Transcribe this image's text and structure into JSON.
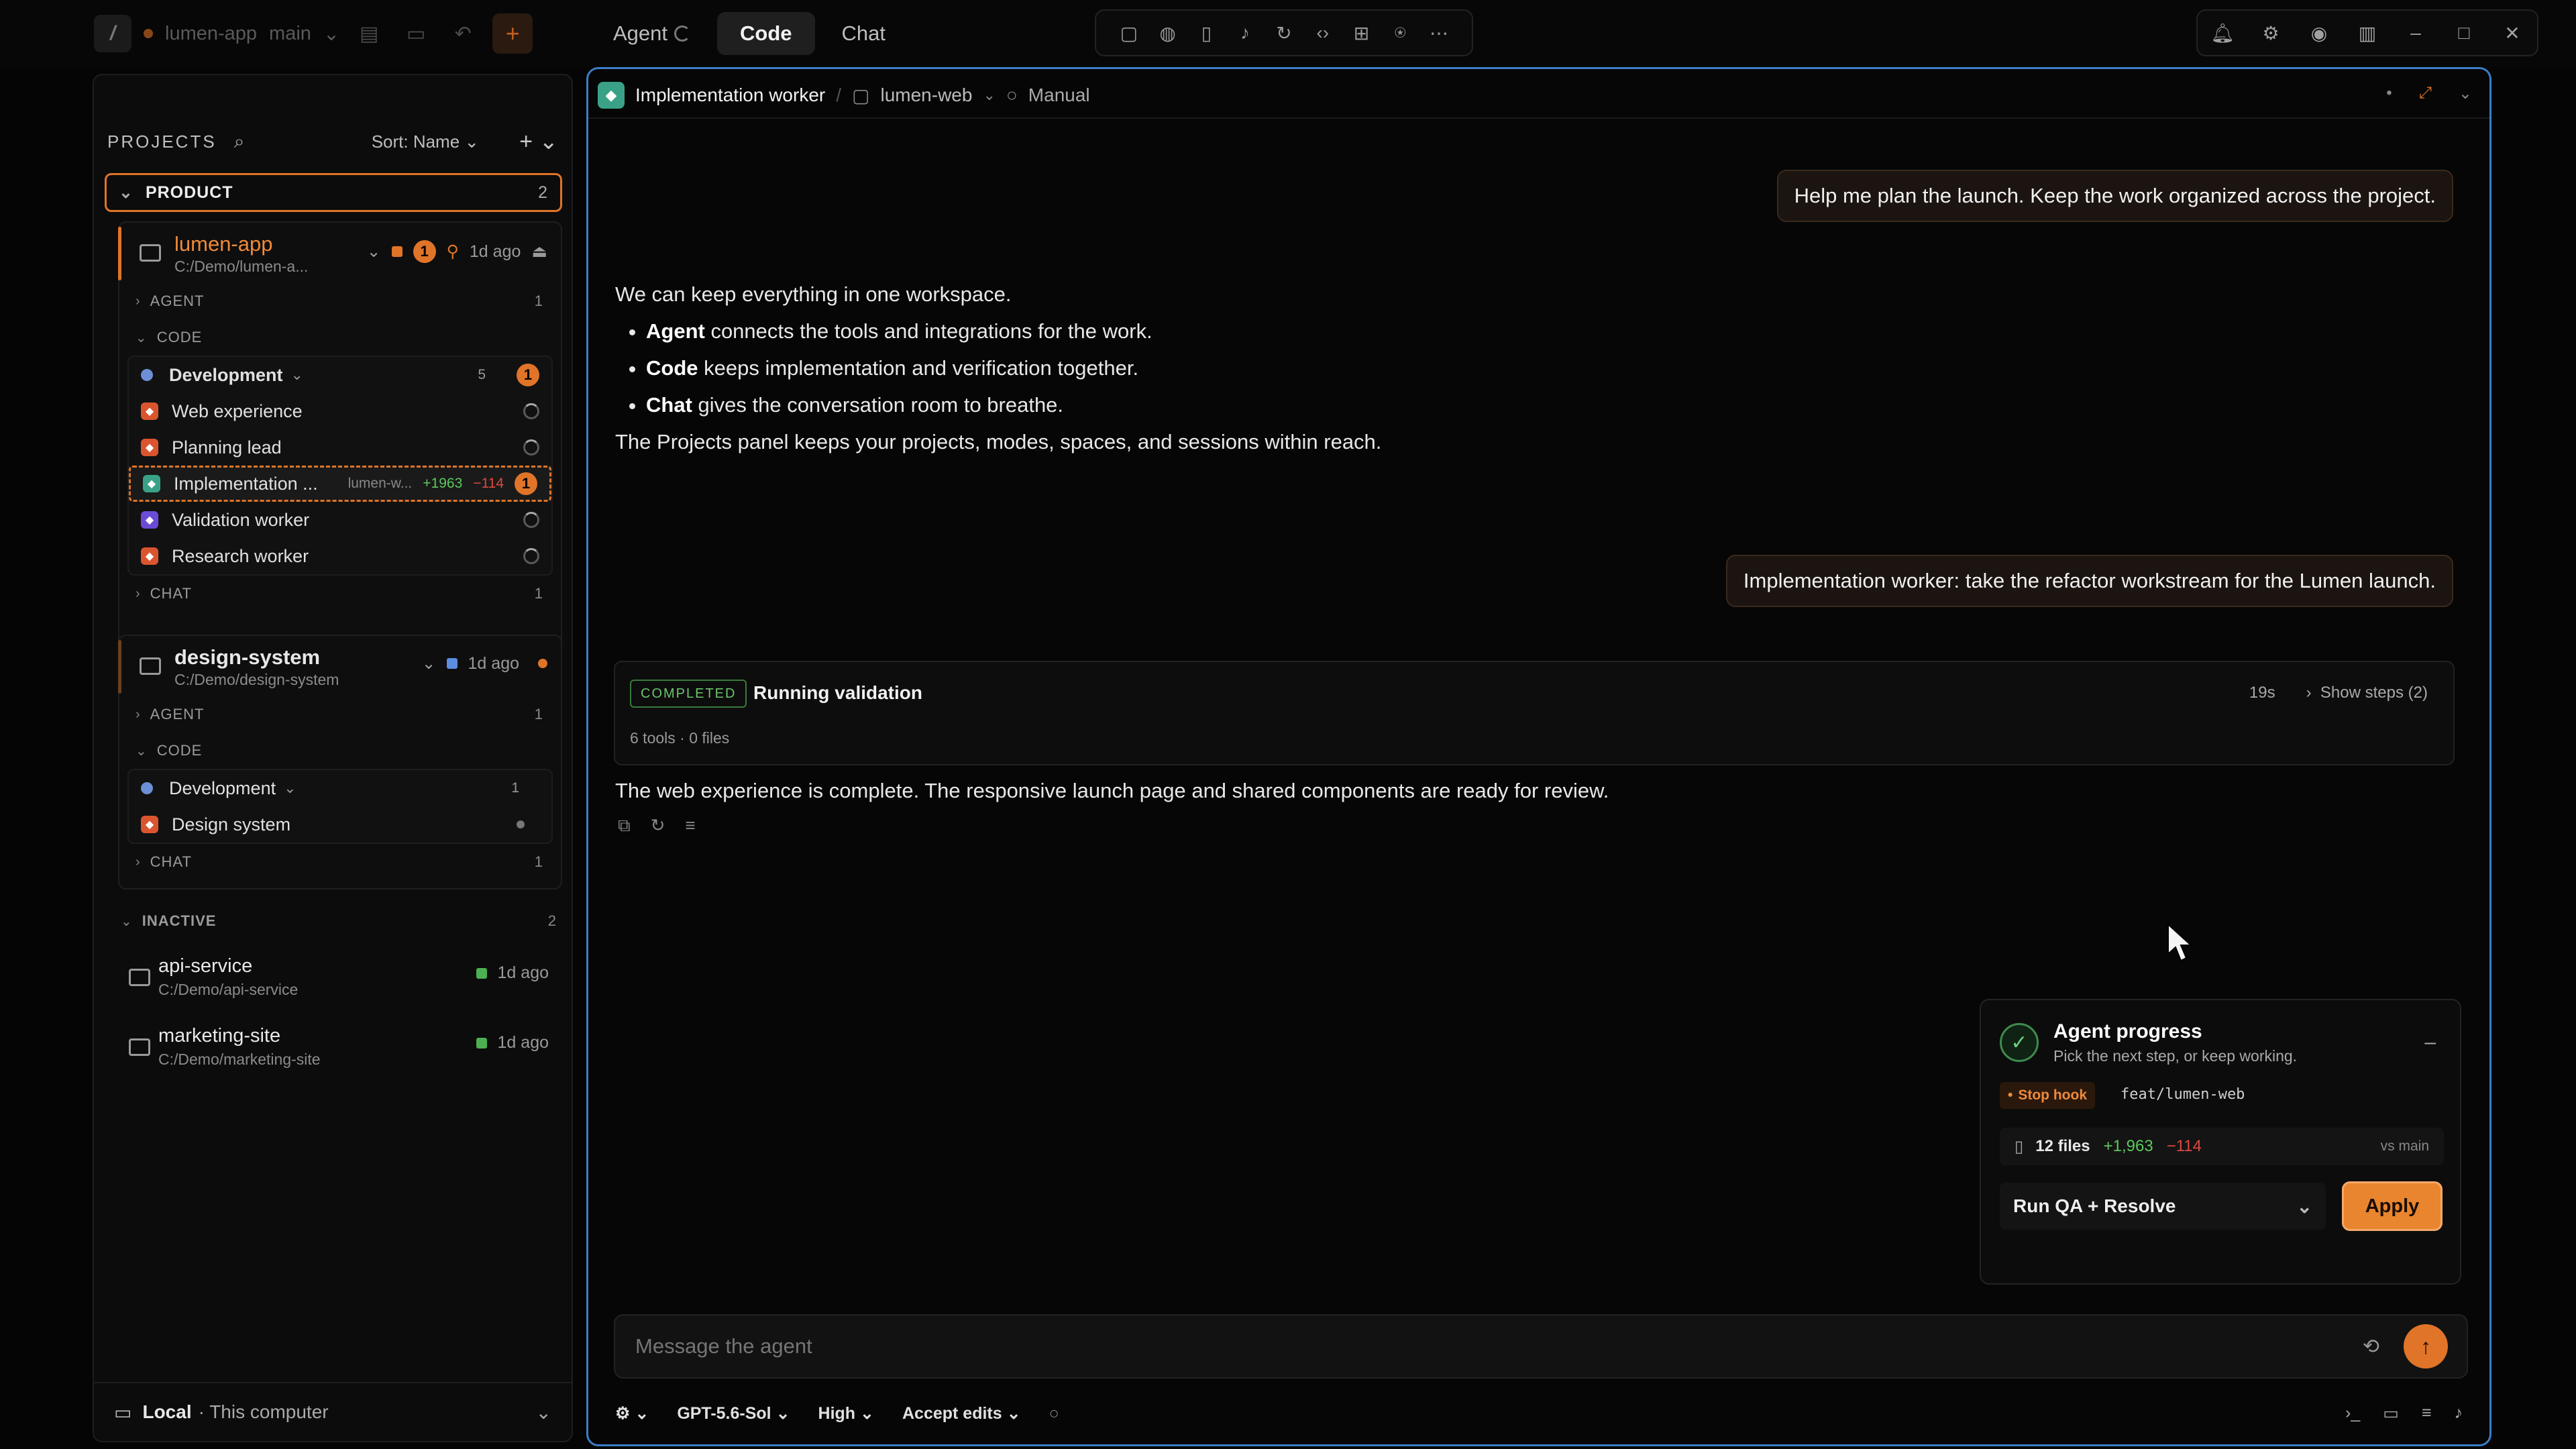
{
  "titlebar": {
    "project": "lumen-app",
    "branch": "main",
    "modes": [
      "Agent",
      "Code",
      "Chat"
    ],
    "active_mode": "Code"
  },
  "sidebar": {
    "title": "PROJECTS",
    "sort": "Sort: Name",
    "group": {
      "label": "PRODUCT",
      "count": "2"
    },
    "projects": [
      {
        "name": "lumen-app",
        "path": "C:/Demo/lumen-a...",
        "badge": "1",
        "time": "1d ago",
        "sections": {
          "agent": "AGENT",
          "agent_count": "1",
          "code": "CODE",
          "chat": "CHAT",
          "chat_count": "1"
        },
        "space": {
          "label": "Development",
          "count": "5",
          "badge": "1"
        },
        "sessions": [
          {
            "label": "Web experience"
          },
          {
            "label": "Planning lead"
          },
          {
            "label": "Implementation ...",
            "sub": "lumen-w...",
            "add": "+1963",
            "del": "−114",
            "badge": "1"
          },
          {
            "label": "Validation worker"
          },
          {
            "label": "Research worker"
          }
        ]
      },
      {
        "name": "design-system",
        "path": "C:/Demo/design-system",
        "time": "1d ago",
        "sections": {
          "agent": "AGENT",
          "agent_count": "1",
          "code": "CODE",
          "chat": "CHAT",
          "chat_count": "1"
        },
        "space": {
          "label": "Development",
          "count": "1"
        },
        "sessions": [
          {
            "label": "Design system"
          }
        ]
      }
    ],
    "inactive": {
      "label": "INACTIVE",
      "count": "2",
      "items": [
        {
          "name": "api-service",
          "path": "C:/Demo/api-service",
          "time": "1d ago"
        },
        {
          "name": "marketing-site",
          "path": "C:/Demo/marketing-site",
          "time": "1d ago"
        }
      ]
    },
    "footer": {
      "label": "Local",
      "sub": "· This computer"
    }
  },
  "main": {
    "crumbs": {
      "worker": "Implementation worker",
      "repo": "lumen-web",
      "mode": "Manual"
    },
    "user_msg_1": "Help me plan the launch. Keep the work organized across the project.",
    "reply": {
      "intro": "We can keep everything in one workspace.",
      "bullets": [
        {
          "strong": "Agent",
          "text": " connects the tools and integrations for the work."
        },
        {
          "strong": "Code",
          "text": " keeps implementation and verification together."
        },
        {
          "strong": "Chat",
          "text": " gives the conversation room to breathe."
        }
      ],
      "outro": "The Projects panel keeps your projects, modes, spaces, and sessions within reach."
    },
    "user_msg_2": "Implementation worker: take the refactor workstream for the Lumen launch.",
    "run": {
      "status": "COMPLETED",
      "title": "Running validation",
      "duration": "19s",
      "steps": "Show steps (2)",
      "sub": "6 tools · 0 files"
    },
    "final": "The web experience is complete. The responsive launch page and shared components are ready for review.",
    "progress": {
      "title": "Agent progress",
      "subtitle": "Pick the next step, or keep working.",
      "hook": "Stop hook",
      "branch": "feat/lumen-web",
      "files": "12 files",
      "add": "+1,963",
      "del": "−114",
      "vs": "vs main",
      "action": "Run QA + Resolve",
      "apply": "Apply"
    },
    "composer": {
      "placeholder": "Message the agent"
    },
    "bottom": {
      "model": "GPT-5.6-Sol",
      "effort": "High",
      "edits": "Accept edits"
    }
  },
  "colors": {
    "accent": "#e07428",
    "focus": "#3b7ec7",
    "success": "#5cc95c",
    "danger": "#e0473f"
  }
}
